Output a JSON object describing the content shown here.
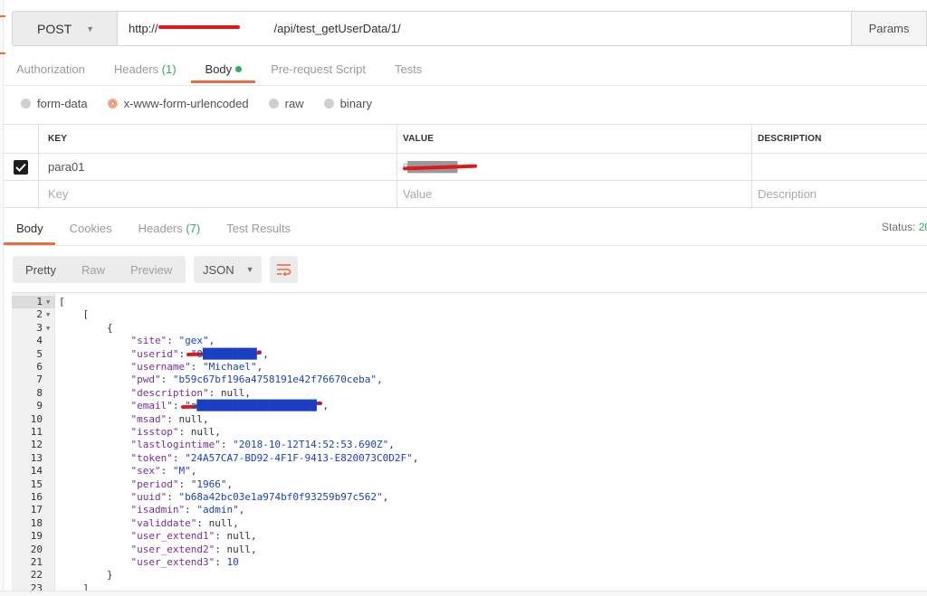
{
  "request": {
    "method": "POST",
    "url": "http://███████████/api/test_getUserData/1/",
    "url_visible_suffix": "/api/test_getUserData/1/",
    "url_prefix": "http://",
    "params_label": "Params"
  },
  "request_tabs": [
    {
      "label": "Authorization",
      "count": "",
      "active": false
    },
    {
      "label": "Headers",
      "count": "(1)",
      "active": false
    },
    {
      "label": "Body",
      "count": "",
      "active": true
    },
    {
      "label": "Pre-request Script",
      "count": "",
      "active": false
    },
    {
      "label": "Tests",
      "count": "",
      "active": false
    }
  ],
  "body_modes": [
    {
      "label": "form-data",
      "selected": false
    },
    {
      "label": "x-www-form-urlencoded",
      "selected": true
    },
    {
      "label": "raw",
      "selected": false
    },
    {
      "label": "binary",
      "selected": false
    }
  ],
  "kv_table": {
    "headers": {
      "key": "KEY",
      "value": "VALUE",
      "description": "DESCRIPTION"
    },
    "rows": [
      {
        "checked": true,
        "key": "para01",
        "value": "0████████",
        "description": ""
      }
    ],
    "placeholders": {
      "key": "Key",
      "value": "Value",
      "description": "Description"
    }
  },
  "response_tabs": [
    {
      "label": "Body",
      "count": "",
      "active": true
    },
    {
      "label": "Cookies",
      "count": "",
      "active": false
    },
    {
      "label": "Headers",
      "count": "(7)",
      "active": false
    },
    {
      "label": "Test Results",
      "count": "",
      "active": false
    }
  ],
  "status": {
    "label": "Status:",
    "value": "20"
  },
  "view_modes": [
    {
      "label": "Pretty",
      "active": true
    },
    {
      "label": "Raw",
      "active": false
    },
    {
      "label": "Preview",
      "active": false
    }
  ],
  "format": "JSON",
  "code_lines": [
    {
      "n": "1",
      "fold": true,
      "text": "["
    },
    {
      "n": "2",
      "fold": true,
      "text": "    ["
    },
    {
      "n": "3",
      "fold": true,
      "text": "        {"
    },
    {
      "n": "4",
      "k": "site",
      "v": "\"gex\"",
      "t": "s"
    },
    {
      "n": "5",
      "k": "userid",
      "v": "\"0█████████\"",
      "t": "s",
      "redact": true
    },
    {
      "n": "6",
      "k": "username",
      "v": "\"Michael\"",
      "t": "s"
    },
    {
      "n": "7",
      "k": "pwd",
      "v": "\"b59c67bf196a4758191e42f76670ceba\"",
      "t": "s"
    },
    {
      "n": "8",
      "k": "description",
      "v": "null",
      "t": "n"
    },
    {
      "n": "9",
      "k": "email",
      "v": "\"a████████████████████\"",
      "t": "s",
      "redact": true
    },
    {
      "n": "10",
      "k": "msad",
      "v": "null",
      "t": "n"
    },
    {
      "n": "11",
      "k": "isstop",
      "v": "null",
      "t": "n"
    },
    {
      "n": "12",
      "k": "lastlogintime",
      "v": "\"2018-10-12T14:52:53.690Z\"",
      "t": "s"
    },
    {
      "n": "13",
      "k": "token",
      "v": "\"24A57CA7-BD92-4F1F-9413-E820073C0D2F\"",
      "t": "s"
    },
    {
      "n": "14",
      "k": "sex",
      "v": "\"M\"",
      "t": "s"
    },
    {
      "n": "15",
      "k": "period",
      "v": "\"1966\"",
      "t": "s"
    },
    {
      "n": "16",
      "k": "uuid",
      "v": "\"b68a42bc03e1a974bf0f93259b97c562\"",
      "t": "s"
    },
    {
      "n": "17",
      "k": "isadmin",
      "v": "\"admin\"",
      "t": "s"
    },
    {
      "n": "18",
      "k": "validdate",
      "v": "null",
      "t": "n"
    },
    {
      "n": "19",
      "k": "user_extend1",
      "v": "null",
      "t": "n"
    },
    {
      "n": "20",
      "k": "user_extend2",
      "v": "null",
      "t": "n"
    },
    {
      "n": "21",
      "k": "user_extend3",
      "v": "10",
      "t": "num",
      "last": true
    },
    {
      "n": "22",
      "fold": false,
      "text": "        }"
    },
    {
      "n": "23",
      "fold": false,
      "text": "    ]"
    }
  ],
  "colors": {
    "accent": "#f26b3a",
    "green": "#2eac5f",
    "redaction": "#e01818"
  }
}
